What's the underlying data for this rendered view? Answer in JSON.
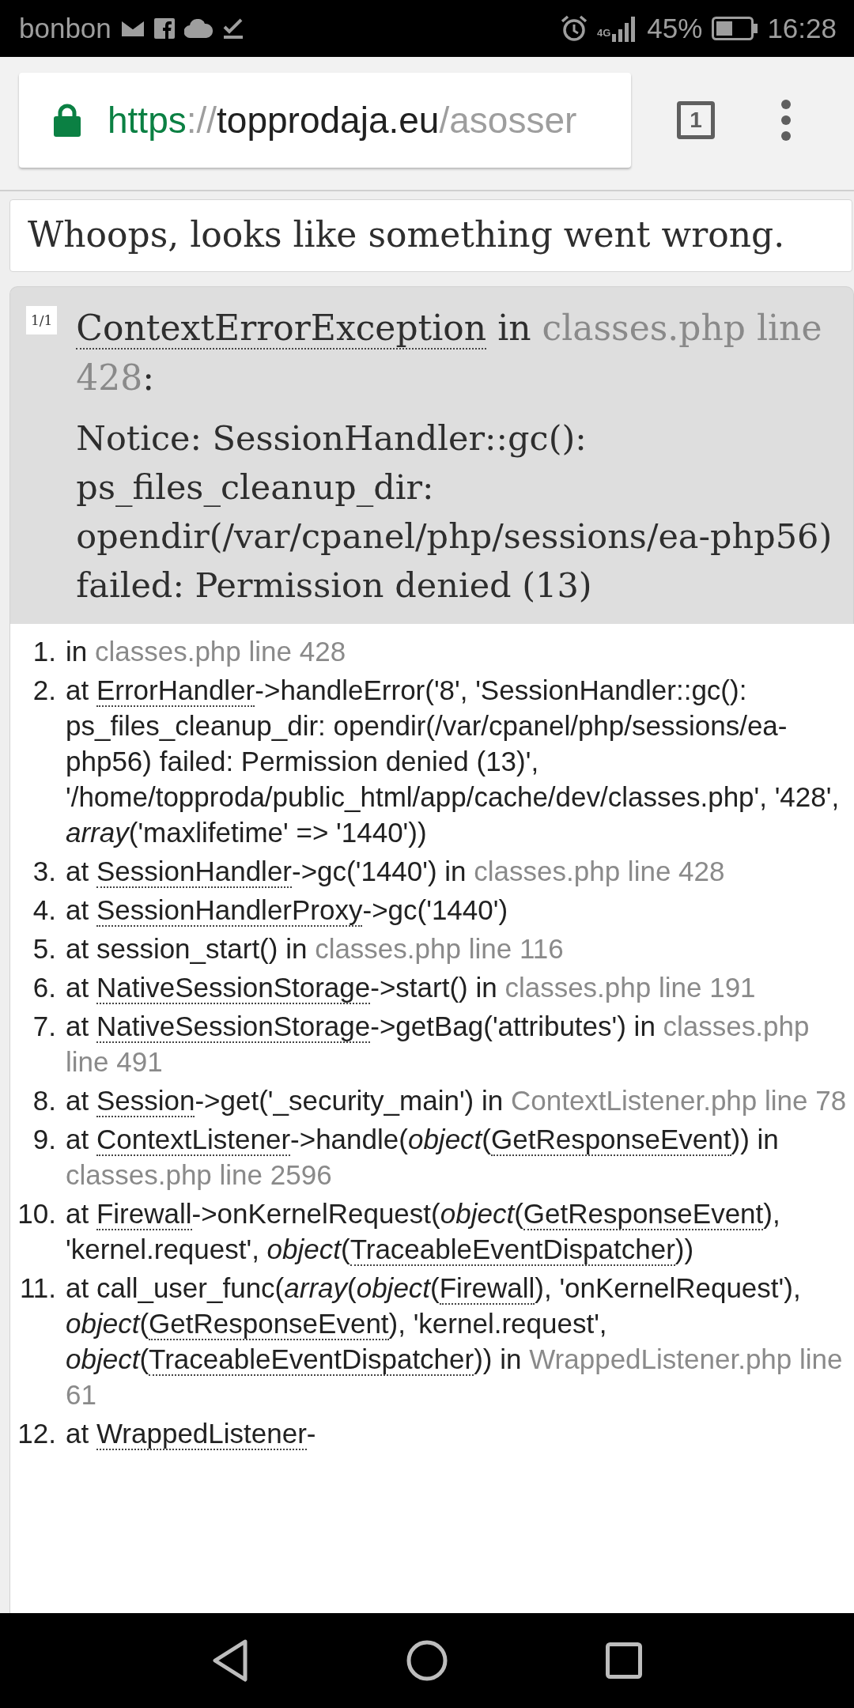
{
  "status_bar": {
    "carrier": "bonbon",
    "network_type": "4G",
    "battery": "45%",
    "time": "16:28"
  },
  "address_bar": {
    "url": [
      {
        "kind": "scheme",
        "text": "https"
      },
      {
        "kind": "separator",
        "text": "://"
      },
      {
        "kind": "host",
        "text": "topprodaja.eu"
      },
      {
        "kind": "path",
        "text": "/asosser"
      }
    ],
    "tab_count": "1"
  },
  "title": "Whoops, looks like something went wrong.",
  "exception": {
    "counter": "1/1",
    "heading": [
      {
        "kind": "class",
        "text": "ContextErrorException"
      },
      {
        "kind": "text",
        "text": " in "
      },
      {
        "kind": "file",
        "text": "classes.php line 428"
      },
      {
        "kind": "text",
        "text": ":"
      }
    ],
    "message": "Notice: SessionHandler::gc(): ps_files_cleanup_dir: opendir(/var/cpanel/php/sessions/ea-php56) failed: Permission denied (13)"
  },
  "trace": [
    {
      "number": "1.",
      "parts": [
        {
          "kind": "text",
          "text": "in "
        },
        {
          "kind": "file",
          "text": "classes.php line 428"
        }
      ]
    },
    {
      "number": "2.",
      "parts": [
        {
          "kind": "text",
          "text": "at "
        },
        {
          "kind": "class",
          "text": "ErrorHandler"
        },
        {
          "kind": "text",
          "text": "->handleError('8', 'SessionHandler::gc(): ps_files_cleanup_dir: opendir(/var/cpanel/php/sessions/ea-php56) failed: Permission denied (13)', '/home/topproda/public_html/app/cache/dev/classes.php', '428', "
        },
        {
          "kind": "em",
          "text": "array"
        },
        {
          "kind": "text",
          "text": "('maxlifetime' => '1440'))"
        }
      ]
    },
    {
      "number": "3.",
      "parts": [
        {
          "kind": "text",
          "text": "at "
        },
        {
          "kind": "class",
          "text": "SessionHandler"
        },
        {
          "kind": "text",
          "text": "->gc('1440') in "
        },
        {
          "kind": "file",
          "text": "classes.php line 428"
        }
      ]
    },
    {
      "number": "4.",
      "parts": [
        {
          "kind": "text",
          "text": "at "
        },
        {
          "kind": "class",
          "text": "SessionHandlerProxy"
        },
        {
          "kind": "text",
          "text": "->gc('1440')"
        }
      ]
    },
    {
      "number": "5.",
      "parts": [
        {
          "kind": "text",
          "text": "at session_start() in "
        },
        {
          "kind": "file",
          "text": "classes.php line 116"
        }
      ]
    },
    {
      "number": "6.",
      "parts": [
        {
          "kind": "text",
          "text": "at "
        },
        {
          "kind": "class",
          "text": "NativeSessionStorage"
        },
        {
          "kind": "text",
          "text": "->start() in "
        },
        {
          "kind": "file",
          "text": "classes.php line 191"
        }
      ]
    },
    {
      "number": "7.",
      "parts": [
        {
          "kind": "text",
          "text": "at "
        },
        {
          "kind": "class",
          "text": "NativeSessionStorage"
        },
        {
          "kind": "text",
          "text": "->getBag('attributes') in "
        },
        {
          "kind": "file",
          "text": "classes.php line 491"
        }
      ]
    },
    {
      "number": "8.",
      "parts": [
        {
          "kind": "text",
          "text": "at "
        },
        {
          "kind": "class",
          "text": "Session"
        },
        {
          "kind": "text",
          "text": "->get('_security_main') in "
        },
        {
          "kind": "file",
          "text": "ContextListener.php line 78"
        }
      ]
    },
    {
      "number": "9.",
      "parts": [
        {
          "kind": "text",
          "text": "at "
        },
        {
          "kind": "class",
          "text": "ContextListener"
        },
        {
          "kind": "text",
          "text": "->handle("
        },
        {
          "kind": "em",
          "text": "object"
        },
        {
          "kind": "text",
          "text": "("
        },
        {
          "kind": "class",
          "text": "GetResponseEvent"
        },
        {
          "kind": "text",
          "text": ")) in "
        },
        {
          "kind": "file",
          "text": "classes.php line 2596"
        }
      ]
    },
    {
      "number": "10.",
      "parts": [
        {
          "kind": "text",
          "text": "at "
        },
        {
          "kind": "class",
          "text": "Firewall"
        },
        {
          "kind": "text",
          "text": "->onKernelRequest("
        },
        {
          "kind": "em",
          "text": "object"
        },
        {
          "kind": "text",
          "text": "("
        },
        {
          "kind": "class",
          "text": "GetResponseEvent"
        },
        {
          "kind": "text",
          "text": "), 'kernel.request', "
        },
        {
          "kind": "em",
          "text": "object"
        },
        {
          "kind": "text",
          "text": "("
        },
        {
          "kind": "class",
          "text": "TraceableEventDispatcher"
        },
        {
          "kind": "text",
          "text": "))"
        }
      ]
    },
    {
      "number": "11.",
      "parts": [
        {
          "kind": "text",
          "text": "at call_user_func("
        },
        {
          "kind": "em",
          "text": "array"
        },
        {
          "kind": "text",
          "text": "("
        },
        {
          "kind": "em",
          "text": "object"
        },
        {
          "kind": "text",
          "text": "("
        },
        {
          "kind": "class",
          "text": "Firewall"
        },
        {
          "kind": "text",
          "text": "), 'onKernelRequest'), "
        },
        {
          "kind": "em",
          "text": "object"
        },
        {
          "kind": "text",
          "text": "("
        },
        {
          "kind": "class",
          "text": "GetResponseEvent"
        },
        {
          "kind": "text",
          "text": "), 'kernel.request', "
        },
        {
          "kind": "em",
          "text": "object"
        },
        {
          "kind": "text",
          "text": "("
        },
        {
          "kind": "class",
          "text": "TraceableEventDispatcher"
        },
        {
          "kind": "text",
          "text": ")) in "
        },
        {
          "kind": "file",
          "text": "WrappedListener.php line 61"
        }
      ]
    },
    {
      "number": "12.",
      "parts": [
        {
          "kind": "text",
          "text": "at "
        },
        {
          "kind": "class",
          "text": "WrappedListener"
        },
        {
          "kind": "text",
          "text": "-"
        }
      ]
    }
  ]
}
